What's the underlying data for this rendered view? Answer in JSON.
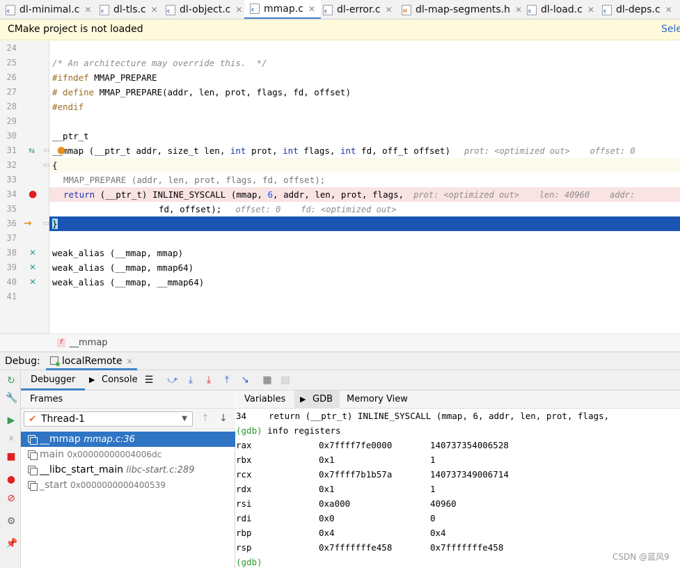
{
  "tabs": [
    {
      "label": "dl-minimal.c",
      "icon": "c-file-icon",
      "active": false
    },
    {
      "label": "dl-tls.c",
      "icon": "c-file-icon",
      "active": false
    },
    {
      "label": "dl-object.c",
      "icon": "c-file-icon",
      "active": false
    },
    {
      "label": "mmap.c",
      "icon": "c-file-icon",
      "active": true
    },
    {
      "label": "dl-error.c",
      "icon": "c-file-icon",
      "active": false
    },
    {
      "label": "dl-map-segments.h",
      "icon": "h-file-icon",
      "active": false
    },
    {
      "label": "dl-load.c",
      "icon": "c-file-icon",
      "active": false
    },
    {
      "label": "dl-deps.c",
      "icon": "c-file-icon",
      "active": false
    }
  ],
  "banner": {
    "message": "CMake project is not loaded",
    "action": "Sele"
  },
  "editor": {
    "line_numbers": [
      "24",
      "25",
      "26",
      "27",
      "28",
      "29",
      "30",
      "31",
      "32",
      "33",
      "34",
      "35",
      "36",
      "37",
      "38",
      "39",
      "40",
      "41"
    ],
    "lines": {
      "l25": "/* An architecture may override this.  */",
      "l26_pp": "#ifndef",
      "l26_rest": " MMAP_PREPARE",
      "l27_pp": "# define",
      "l27_rest": " MMAP_PREPARE(addr, len, prot, flags, fd, offset)",
      "l28_pp": "#endif",
      "l30": "__ptr_t",
      "l31_a": "__mmap (__ptr_t addr, size_t len, ",
      "l31_kw1": "int",
      "l31_b": " prot, ",
      "l31_kw2": "int",
      "l31_c": " flags, ",
      "l31_kw3": "int",
      "l31_d": " fd, off_t offset)",
      "l31_hint": "prot: <optimized out>    offset: 0",
      "l32": "{",
      "l33": "MMAP_PREPARE (addr, len, prot, flags, fd, offset);",
      "l34_kw": "return",
      "l34_a": " (__ptr_t) INLINE_SYSCALL (mmap, ",
      "l34_num": "6",
      "l34_b": ", addr, len, prot, flags,",
      "l34_hint": "prot: <optimized out>    len: 40960    addr:",
      "l35": "fd, offset);",
      "l35_hint": "offset: 0    fd: <optimized out>",
      "l36": "}",
      "l38": "weak_alias (__mmap, mmap)",
      "l39": "weak_alias (__mmap, mmap64)",
      "l40": "weak_alias (__mmap, __mmap64)"
    },
    "breadcrumb": "__mmap",
    "breadcrumb_icon": "f"
  },
  "debug": {
    "label": "Debug:",
    "config": "localRemote",
    "subtabs": {
      "debugger": "Debugger",
      "console": "Console"
    },
    "frames": {
      "header": "Frames",
      "thread": "Thread-1",
      "items": [
        {
          "name": "__mmap",
          "loc": "mmap.c:36"
        },
        {
          "name": "main",
          "loc": "0x00000000004006dc"
        },
        {
          "name": "__libc_start_main",
          "loc": "libc-start.c:289"
        },
        {
          "name": "_start",
          "loc": "0x0000000000400539"
        }
      ]
    },
    "gdb": {
      "tabs": [
        "Variables",
        "GDB",
        "Memory View"
      ],
      "line1": "34\t  return (__ptr_t) INLINE_SYSCALL (mmap, 6, addr, len, prot, flags,",
      "line1_num": "34",
      "line1_text": "return (__ptr_t) INLINE_SYSCALL (mmap, 6, addr, len, prot, flags,",
      "prompt": "(gdb)",
      "cmd": " info registers",
      "registers": [
        {
          "name": "rax",
          "hex": "0x7ffff7fe0000",
          "dec": "140737354006528"
        },
        {
          "name": "rbx",
          "hex": "0x1",
          "dec": "1"
        },
        {
          "name": "rcx",
          "hex": "0x7ffff7b1b57a",
          "dec": "140737349006714"
        },
        {
          "name": "rdx",
          "hex": "0x1",
          "dec": "1"
        },
        {
          "name": "rsi",
          "hex": "0xa000",
          "dec": "40960"
        },
        {
          "name": "rdi",
          "hex": "0x0",
          "dec": "0"
        },
        {
          "name": "rbp",
          "hex": "0x4",
          "dec": "0x4"
        },
        {
          "name": "rsp",
          "hex": "0x7fffffffe458",
          "dec": "0x7fffffffe458"
        }
      ],
      "end_prompt": "(gdb)"
    }
  },
  "watermark": "CSDN @蓝风9",
  "colors": {
    "accent": "#4083c9",
    "selection": "#2f75c4",
    "exec_line": "#1a55b3",
    "breakpoint": "#e02020"
  }
}
